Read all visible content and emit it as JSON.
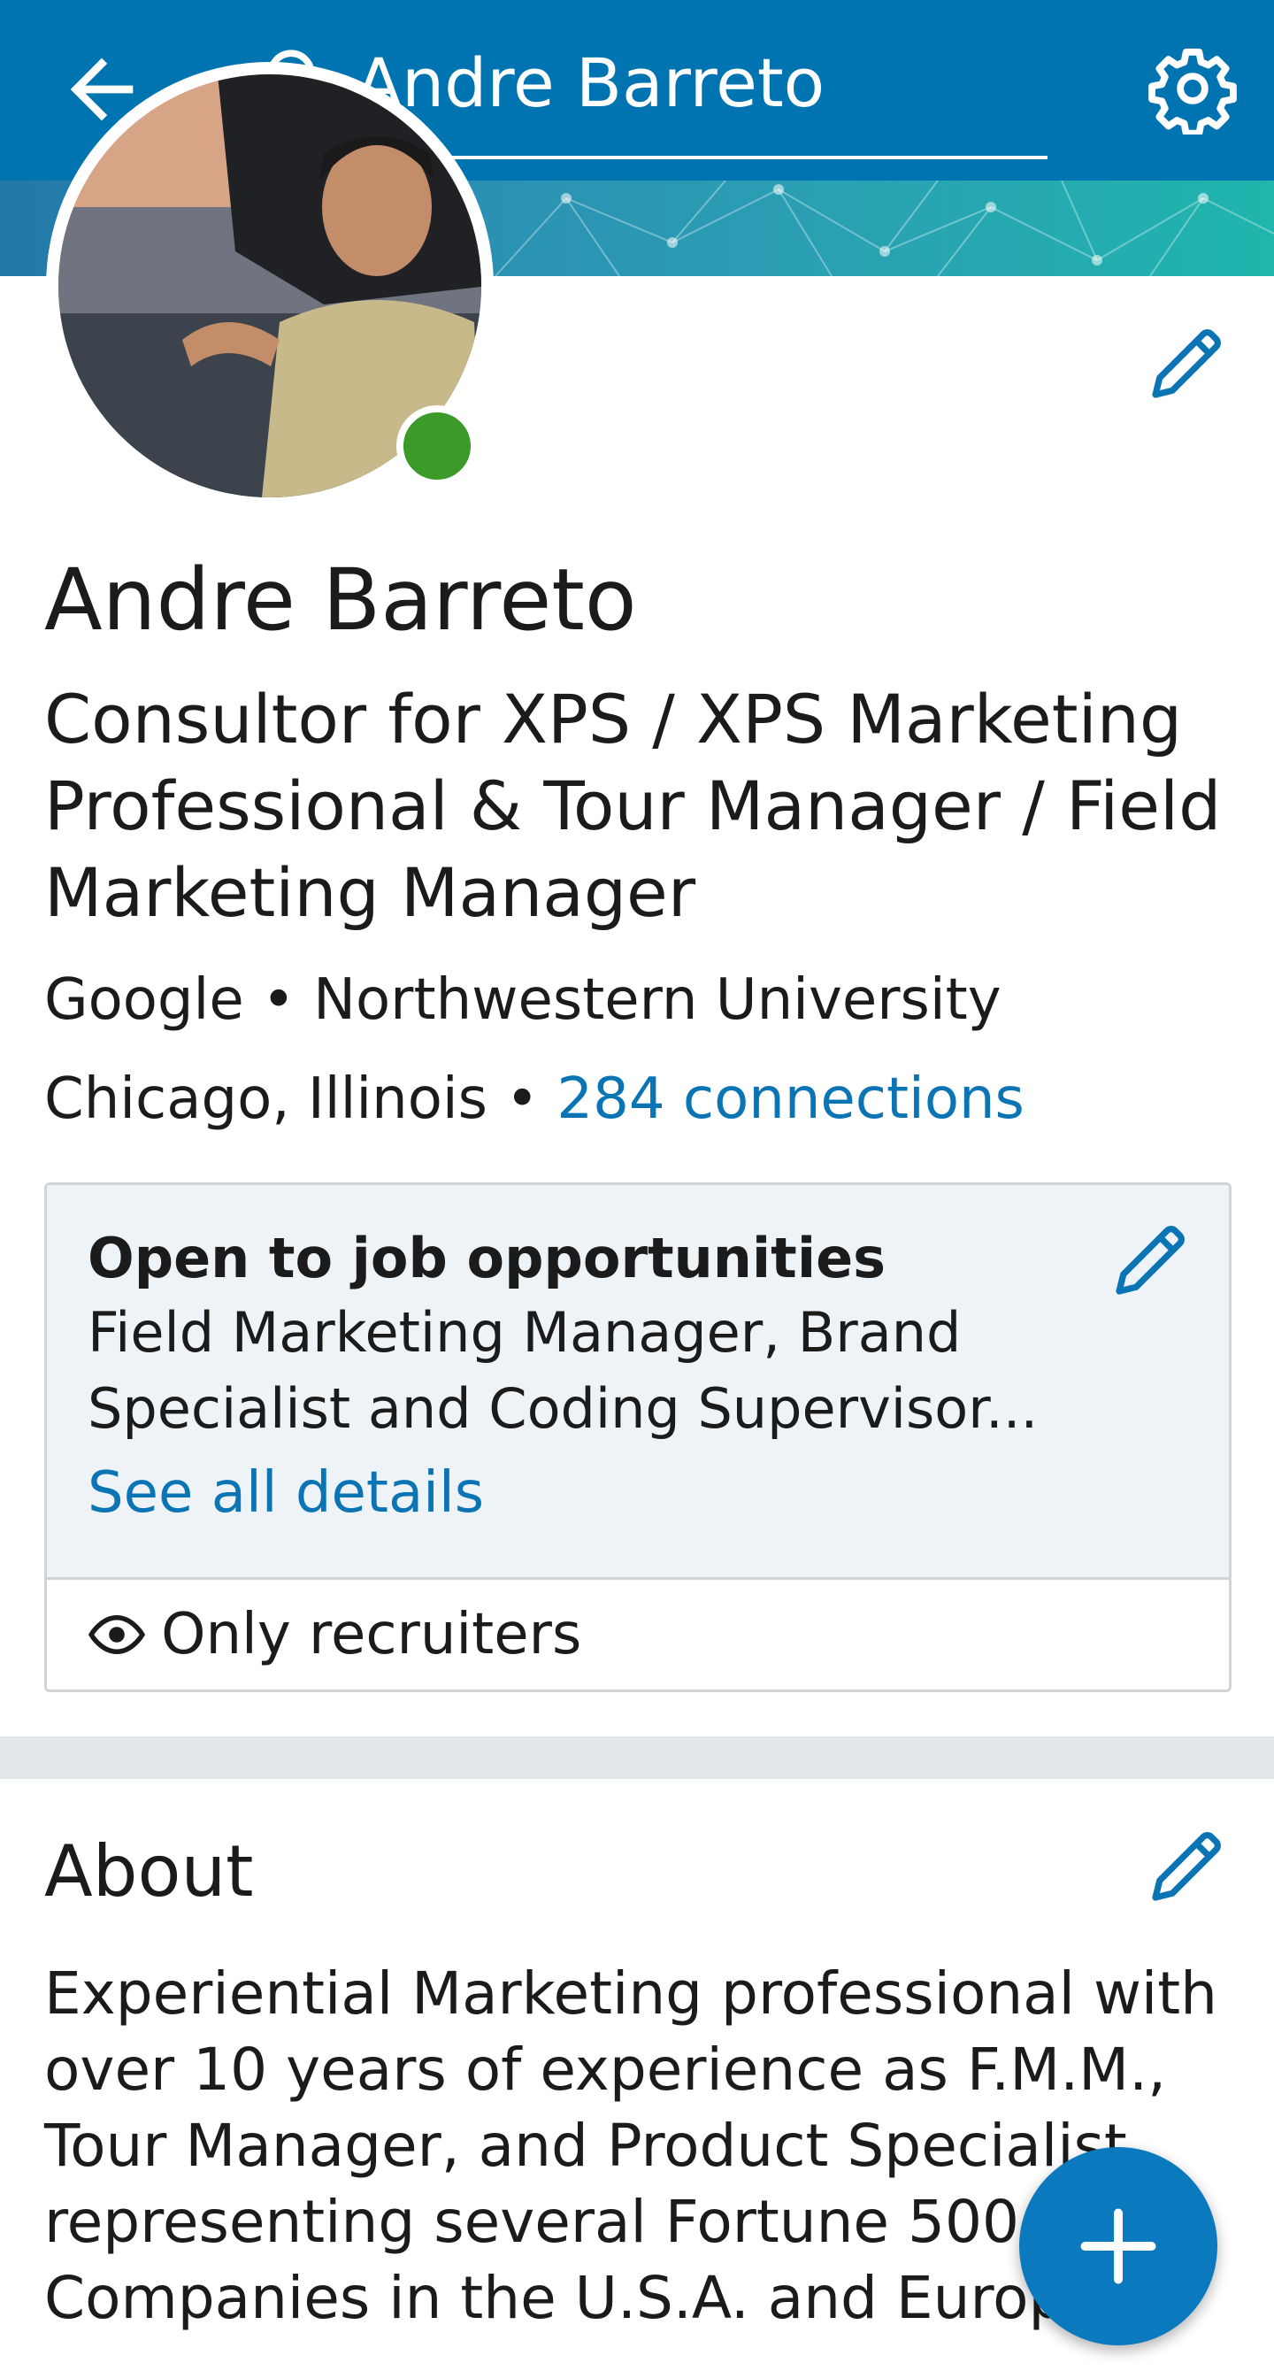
{
  "header": {
    "search_value": "Andre Barreto"
  },
  "profile": {
    "name": "Andre Barreto",
    "headline": "Consultor for XPS / XPS Marketing Professional & Tour Manager / Field Marketing Manager",
    "company": "Google",
    "school": "Northwestern University",
    "location": "Chicago, Illinois",
    "separator": "•",
    "connections": "284 connections",
    "online": true
  },
  "job_card": {
    "title": "Open to job opportunities",
    "description": "Field Marketing Manager, Brand Specialist and Coding Supervisor...",
    "link": "See all details",
    "visibility": "Only recruiters"
  },
  "about": {
    "title": "About",
    "text": "Experiential Marketing professional with over 10 years of experience as F.M.M., Tour Manager, and Product Specialist representing several Fortune 500 Companies in the U.S.A. and Europe."
  },
  "colors": {
    "brand": "#0073b1",
    "link": "#0b74b4",
    "online": "#3b9a28",
    "fab": "#0b79be"
  },
  "icons": [
    "back-arrow-icon",
    "search-icon",
    "gear-icon",
    "pencil-icon",
    "eye-icon",
    "plus-icon"
  ]
}
